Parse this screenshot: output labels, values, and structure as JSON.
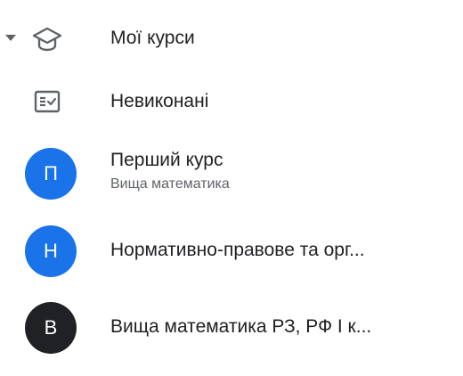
{
  "nav": {
    "my_courses": {
      "label": "Мої курси",
      "icon": "school-icon",
      "expanded": true
    },
    "todo": {
      "label": "Невиконані",
      "icon": "assignment-checklist-icon"
    },
    "courses": [
      {
        "initial": "П",
        "title": "Перший курс",
        "subtitle": "Вища математика",
        "color": "#1a73e8"
      },
      {
        "initial": "Н",
        "title": "Нормативно-правове та орг...",
        "color": "#1a73e8"
      },
      {
        "initial": "В",
        "title": "Вища математика РЗ, РФ І к...",
        "color": "#202124"
      }
    ]
  }
}
